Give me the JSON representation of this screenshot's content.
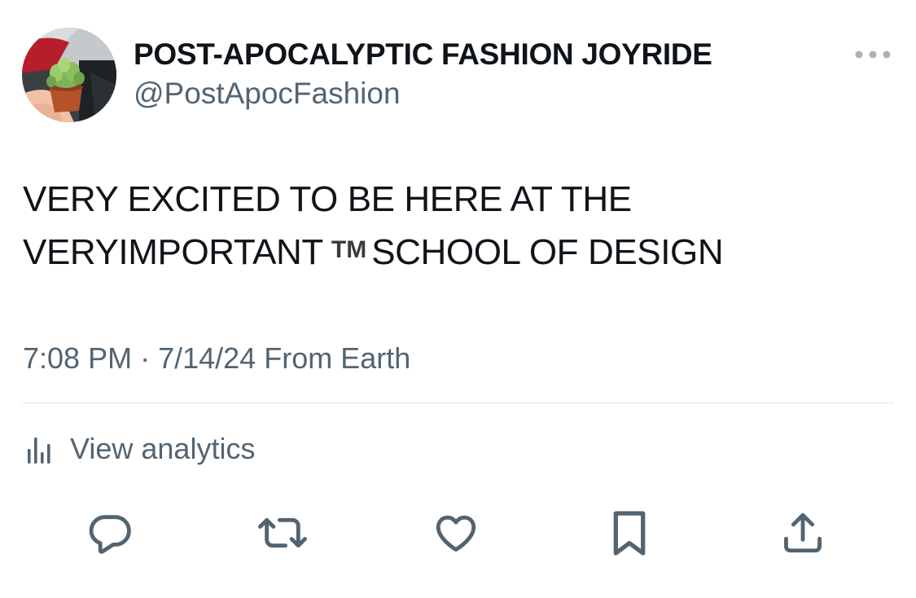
{
  "tweet": {
    "author": {
      "display_name": "POST-APOCALYPTIC FASHION JOYRIDE",
      "handle": "@PostApocFashion"
    },
    "text": {
      "line1": "VERY EXCITED TO BE HERE AT THE",
      "line2_before": "VERYIMPORTANT",
      "trademark": "TM",
      "line2_after": "SCHOOL OF DESIGN"
    },
    "meta": {
      "time": "7:08 PM",
      "separator": "·",
      "date": "7/14/24",
      "source": "From Earth"
    },
    "analytics": {
      "label": "View analytics"
    },
    "actions": [
      {
        "name": "reply",
        "icon": "reply-icon"
      },
      {
        "name": "retweet",
        "icon": "retweet-icon"
      },
      {
        "name": "like",
        "icon": "heart-icon"
      },
      {
        "name": "bookmark",
        "icon": "bookmark-icon"
      },
      {
        "name": "share",
        "icon": "share-icon"
      }
    ]
  },
  "colors": {
    "text_primary": "#0f1419",
    "text_secondary": "#536471",
    "divider": "#dfe3e6",
    "background": "#ffffff"
  }
}
